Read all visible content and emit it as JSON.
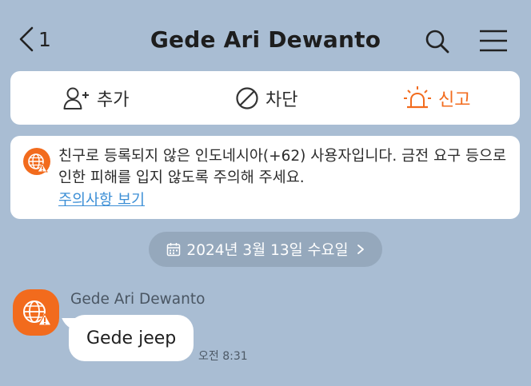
{
  "header": {
    "back_count": "1",
    "title": "Gede Ari Dewanto"
  },
  "actions": {
    "add_label": "추가",
    "block_label": "차단",
    "report_label": "신고"
  },
  "warning": {
    "message": "친구로 등록되지 않은 인도네시아(+62) 사용자입니다. 금전 요구 등으로 인한 피해를 입지 않도록 주의해 주세요.",
    "link_text": "주의사항 보기"
  },
  "date_divider": {
    "label": "2024년 3월 13일 수요일"
  },
  "message": {
    "sender": "Gede Ari Dewanto",
    "text": "Gede jeep",
    "time": "오전 8:31"
  },
  "colors": {
    "background": "#a9bdd3",
    "accent_orange": "#f26b1d",
    "link_blue": "#3c8fd6",
    "date_pill": "#95a8bc"
  },
  "icons": [
    "chevron-left-icon",
    "search-icon",
    "menu-icon",
    "add-friend-icon",
    "block-icon",
    "siren-icon",
    "globe-warning-icon",
    "calendar-icon",
    "chevron-right-icon"
  ]
}
